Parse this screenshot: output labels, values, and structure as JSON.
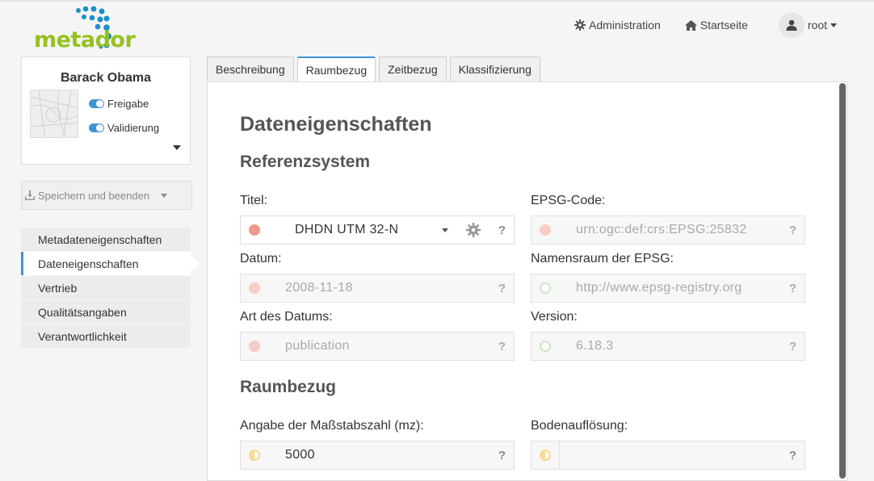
{
  "header": {
    "logo_text": "metador",
    "nav": [
      {
        "label": "Administration",
        "icon": "gear-icon"
      },
      {
        "label": "Startseite",
        "icon": "home-icon"
      }
    ],
    "user": {
      "name": "root",
      "icon": "user-icon"
    }
  },
  "card": {
    "title": "Barack Obama",
    "toggles": [
      {
        "label": "Freigabe",
        "on": true
      },
      {
        "label": "Validierung",
        "on": true
      }
    ]
  },
  "save_button": {
    "label": "Speichern und beenden",
    "icon": "download-icon"
  },
  "sidenav": {
    "items": [
      {
        "label": "Metadateneigenschaften",
        "active": false
      },
      {
        "label": "Dateneigenschaften",
        "active": true
      },
      {
        "label": "Vertrieb",
        "active": false
      },
      {
        "label": "Qualitätsangaben",
        "active": false
      },
      {
        "label": "Verantwortlichkeit",
        "active": false
      }
    ]
  },
  "tabs": [
    {
      "label": "Beschreibung",
      "active": false
    },
    {
      "label": "Raumbezug",
      "active": true
    },
    {
      "label": "Zeitbezug",
      "active": false
    },
    {
      "label": "Klassifizierung",
      "active": false
    }
  ],
  "main": {
    "heading": "Dateneigenschaften",
    "section1": "Referenzsystem",
    "section2": "Raumbezug",
    "fields": {
      "titel": {
        "label": "Titel:",
        "value": "DHDN UTM 32-N",
        "status": "red"
      },
      "epsg_code": {
        "label": "EPSG-Code:",
        "value": "urn:ogc:def:crs:EPSG:25832",
        "status": "red-light"
      },
      "datum": {
        "label": "Datum:",
        "value": "2008-11-18",
        "status": "red-light"
      },
      "namensraum": {
        "label": "Namensraum der EPSG:",
        "value": "http://www.epsg-registry.org",
        "status": "green"
      },
      "art_datum": {
        "label": "Art des Datums:",
        "value": "publication",
        "status": "red-light"
      },
      "version": {
        "label": "Version:",
        "value": "6.18.3",
        "status": "green"
      },
      "massstab": {
        "label": "Angabe der Maßstabszahl (mz):",
        "value": "5000",
        "status": "half"
      },
      "bodenaufloesung": {
        "label": "Bodenauflösung:",
        "value": "",
        "status": "half"
      }
    },
    "help_mark": "?"
  },
  "colors": {
    "accent": "#3d95d3",
    "logo_green": "#95c11f",
    "logo_blue": "#1b8fc9"
  }
}
